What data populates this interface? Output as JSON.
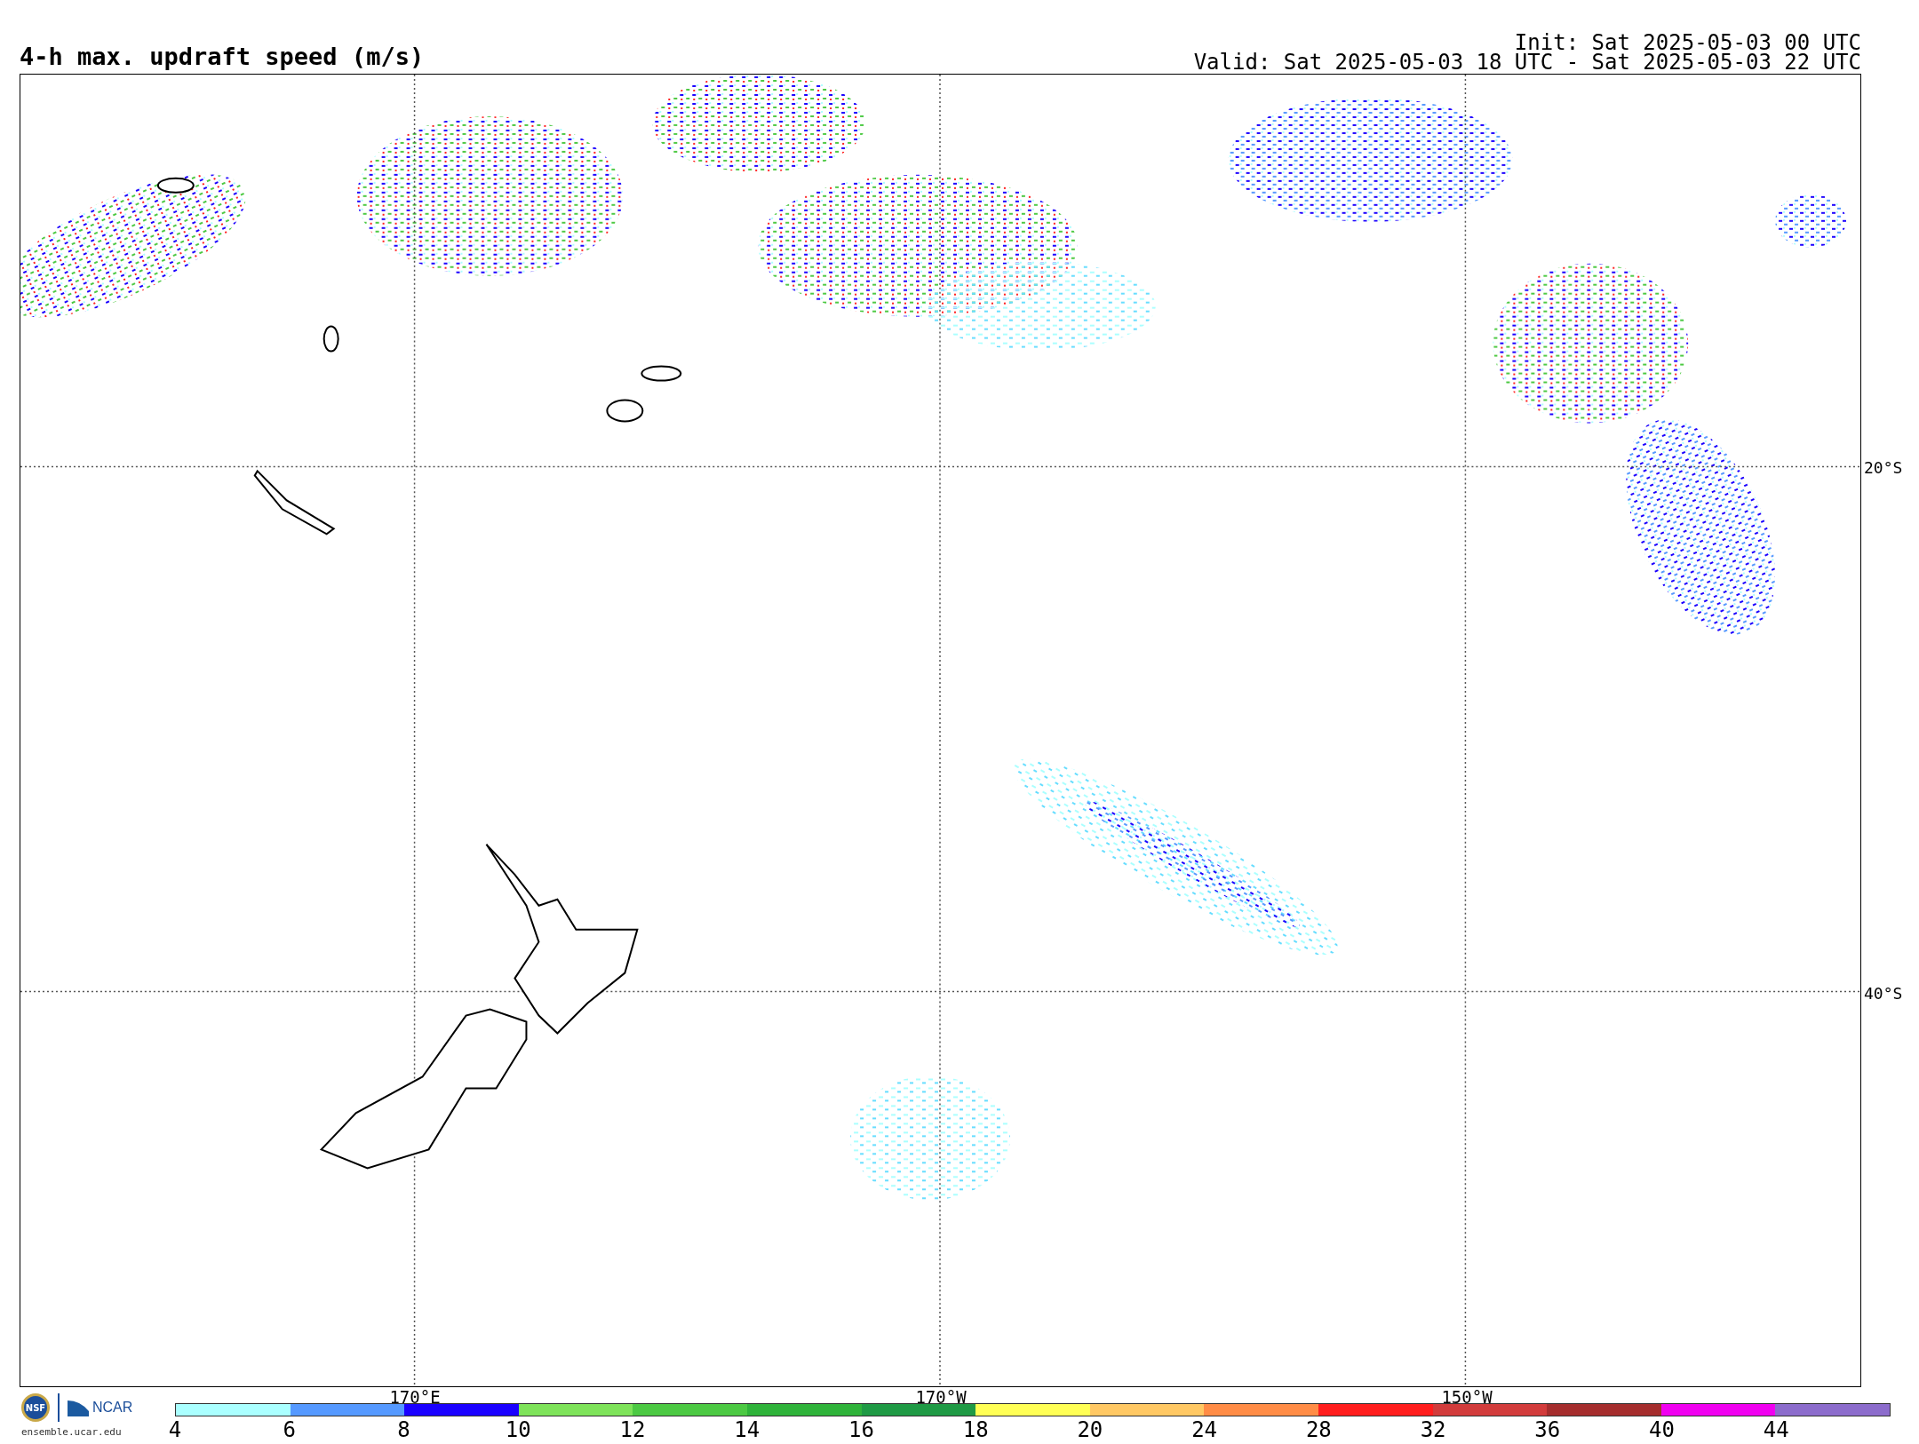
{
  "title": "4-h max. updraft speed (m/s)",
  "init": "Init: Sat 2025-05-03 00 UTC",
  "valid": "Valid: Sat 2025-05-03 18 UTC - Sat 2025-05-03 22 UTC",
  "map": {
    "lat_labels": [
      "20°S",
      "40°S"
    ],
    "lon_labels": [
      "170°E",
      "170°W",
      "150°W"
    ]
  },
  "colorbar": [
    {
      "label": "4",
      "color": "#aaffff"
    },
    {
      "label": "6",
      "color": "#5599ff"
    },
    {
      "label": "8",
      "color": "#1a00ff"
    },
    {
      "label": "10",
      "color": "#7ee35a"
    },
    {
      "label": "12",
      "color": "#4cc943"
    },
    {
      "label": "14",
      "color": "#2fb33a"
    },
    {
      "label": "16",
      "color": "#1f9a45"
    },
    {
      "label": "18",
      "color": "#ffff55"
    },
    {
      "label": "20",
      "color": "#ffc864"
    },
    {
      "label": "24",
      "color": "#ff8c46"
    },
    {
      "label": "28",
      "color": "#ff1e1e"
    },
    {
      "label": "32",
      "color": "#d23c3c"
    },
    {
      "label": "36",
      "color": "#a52d2d"
    },
    {
      "label": "40",
      "color": "#f000f0"
    },
    {
      "label": "44",
      "color": "#8c6ccc"
    }
  ],
  "logos": {
    "nsf": "NSF",
    "ncar": "NCAR",
    "site": "ensemble.ucar.edu"
  }
}
